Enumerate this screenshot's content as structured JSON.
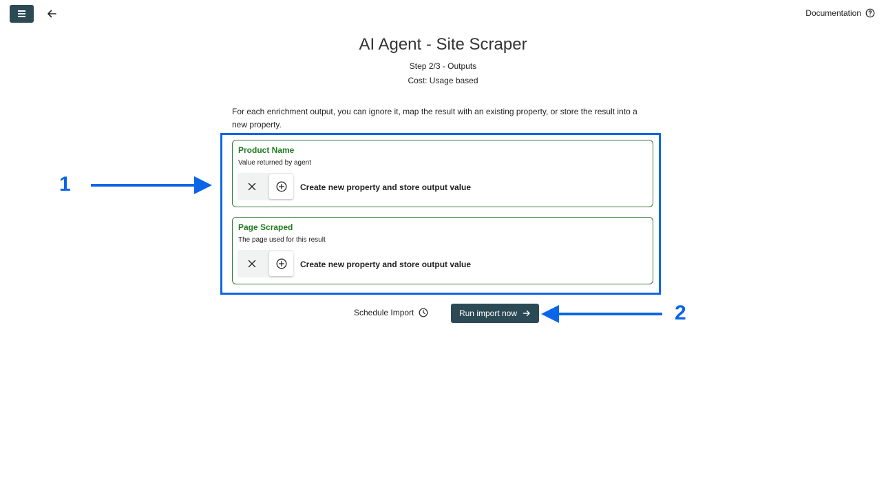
{
  "header": {
    "documentation_label": "Documentation"
  },
  "page": {
    "title": "AI Agent - Site Scraper",
    "step": "Step 2/3 - Outputs",
    "cost": "Cost: Usage based",
    "intro": "For each enrichment output, you can ignore it, map the result with an existing property, or store the result into a new property."
  },
  "outputs": [
    {
      "name": "Product Name",
      "description": "Value returned by agent",
      "selected_option": "Create new property and store output value"
    },
    {
      "name": "Page Scraped",
      "description": "The page used for this result",
      "selected_option": "Create new property and store output value"
    }
  ],
  "actions": {
    "schedule_label": "Schedule Import",
    "run_label": "Run import now"
  },
  "annotations": {
    "marker_1": "1",
    "marker_2": "2",
    "color": "#0a66e8"
  },
  "colors": {
    "primary_button": "#2c4a55",
    "card_border": "#2e7d32",
    "card_title": "#1e7a1e"
  }
}
